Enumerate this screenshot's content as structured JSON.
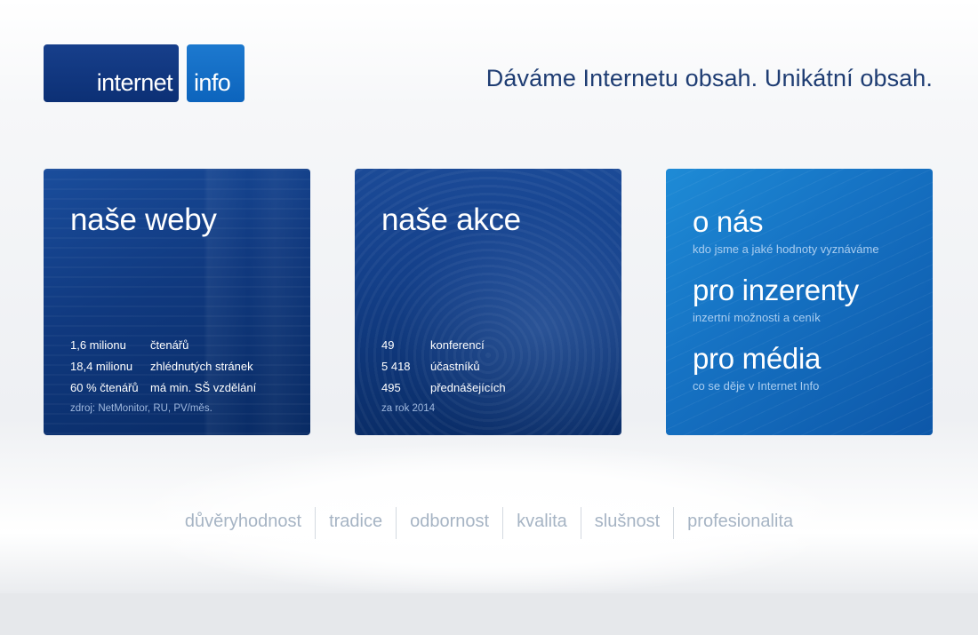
{
  "logo": {
    "part1": "internet",
    "part2": "info"
  },
  "tagline": "Dáváme Internetu obsah. Unikátní obsah.",
  "cards": {
    "weby": {
      "title": "naše weby",
      "stats": [
        {
          "num": "1,6 milionu",
          "label": "čtenářů"
        },
        {
          "num": "18,4 milionu",
          "label": "zhlédnutých stránek"
        },
        {
          "num": "60 % čtenářů",
          "label": "má min. SŠ vzdělání"
        }
      ],
      "source": "zdroj: NetMonitor, RU, PV/měs."
    },
    "akce": {
      "title": "naše akce",
      "stats": [
        {
          "num": "49",
          "label": "konferencí"
        },
        {
          "num": "5 418",
          "label": "účastníků"
        },
        {
          "num": "495",
          "label": "přednášejících"
        }
      ],
      "source": "za rok 2014"
    },
    "menu": [
      {
        "title": "o nás",
        "subtitle": "kdo jsme a jaké hodnoty vyznáváme"
      },
      {
        "title": "pro inzerenty",
        "subtitle": "inzertní možnosti a ceník"
      },
      {
        "title": "pro média",
        "subtitle": "co se děje v Internet Info"
      }
    ]
  },
  "values": [
    "důvěryhodnost",
    "tradice",
    "odbornost",
    "kvalita",
    "slušnost",
    "profesionalita"
  ]
}
